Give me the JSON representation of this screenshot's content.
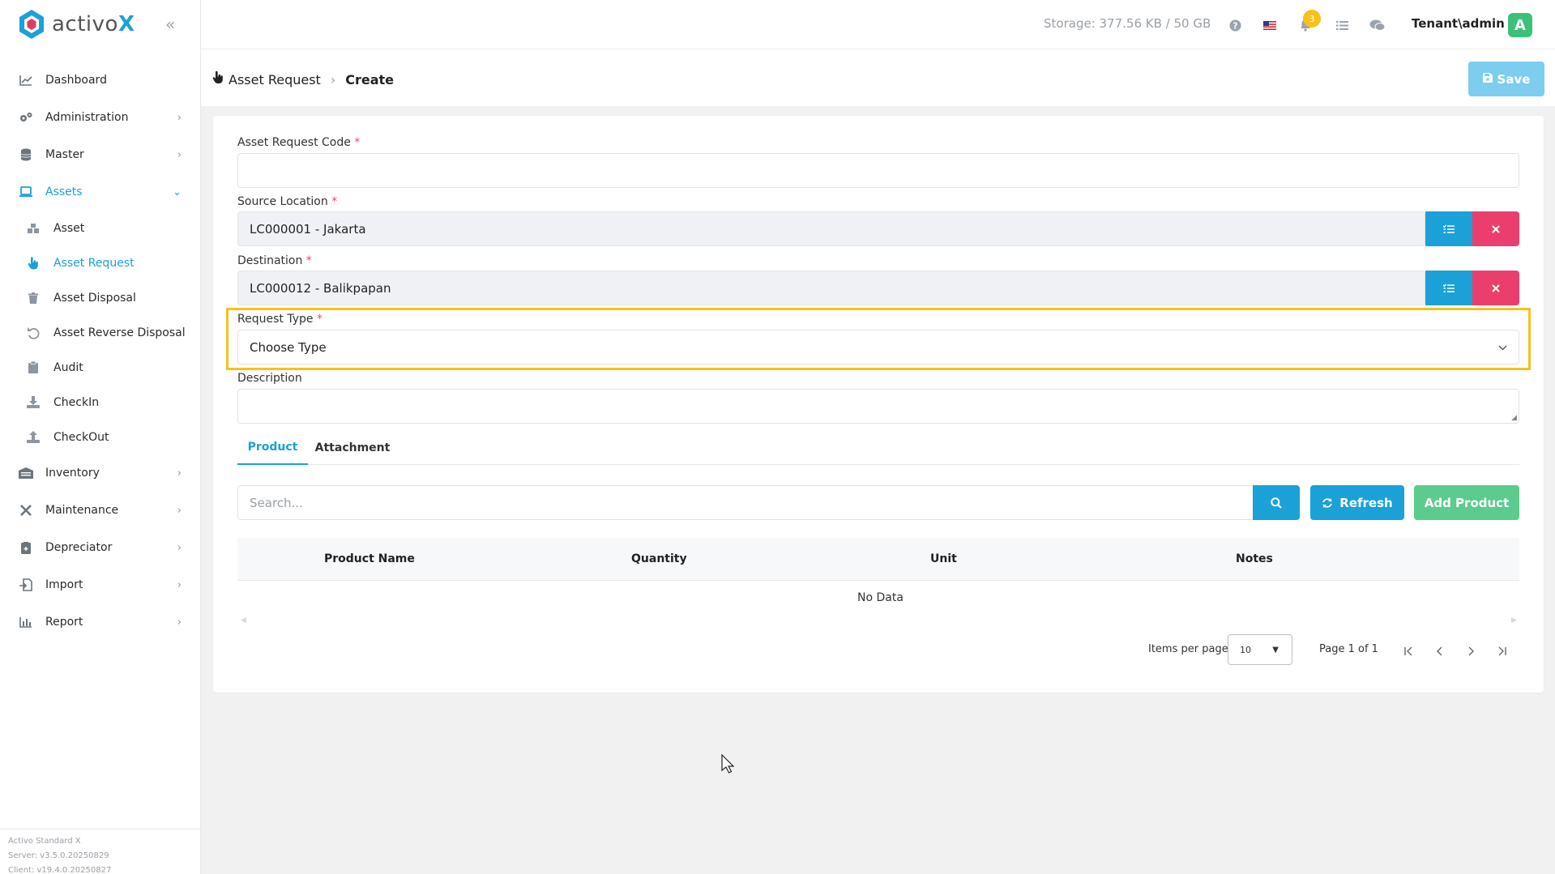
{
  "brand": {
    "name": "activo",
    "x": "X"
  },
  "sidebar": {
    "items": [
      {
        "label": "Dashboard",
        "icon": "chart-line-icon"
      },
      {
        "label": "Administration",
        "icon": "gears-icon"
      },
      {
        "label": "Master",
        "icon": "database-icon"
      },
      {
        "label": "Assets",
        "icon": "laptop-icon"
      },
      {
        "label": "Inventory",
        "icon": "warehouse-icon"
      },
      {
        "label": "Maintenance",
        "icon": "tools-icon"
      },
      {
        "label": "Depreciator",
        "icon": "calculator-icon"
      },
      {
        "label": "Import",
        "icon": "file-import-icon"
      },
      {
        "label": "Report",
        "icon": "bar-chart-icon"
      }
    ],
    "assets_sub": [
      {
        "label": "Asset",
        "icon": "boxes-icon"
      },
      {
        "label": "Asset Request",
        "icon": "hand-pointer-icon"
      },
      {
        "label": "Asset Disposal",
        "icon": "trash-icon"
      },
      {
        "label": "Asset Reverse Disposal",
        "icon": "undo-icon"
      },
      {
        "label": "Audit",
        "icon": "clipboard-icon"
      },
      {
        "label": "CheckIn",
        "icon": "download-icon"
      },
      {
        "label": "CheckOut",
        "icon": "upload-icon"
      }
    ],
    "footer": {
      "product": "Activo Standard X",
      "server": "Server: v3.5.0.20250829",
      "client": "Client: v19.4.0.20250827"
    }
  },
  "topbar": {
    "storage": "Storage: 377.56 KB / 50 GB",
    "notification_count": "3",
    "user": "Tenant\\admin",
    "avatar_letter": "A"
  },
  "breadcrumb": {
    "parent": "Asset Request",
    "current": "Create"
  },
  "save_label": "Save",
  "form": {
    "code_label": "Asset Request Code",
    "code_value": "",
    "source_label": "Source Location",
    "source_value": "LC000001 - Jakarta",
    "destination_label": "Destination",
    "destination_value": "LC000012 - Balikpapan",
    "request_type_label": "Request Type",
    "request_type_value": "Choose Type",
    "description_label": "Description",
    "required_mark": "*"
  },
  "tabs": [
    "Product",
    "Attachment"
  ],
  "product": {
    "search_placeholder": "Search...",
    "refresh_label": "Refresh",
    "add_label": "Add Product",
    "columns": [
      "Product Name",
      "Quantity",
      "Unit",
      "Notes"
    ],
    "empty": "No Data",
    "items_per_page_label": "Items per page",
    "items_per_page": "10",
    "page_info": "Page 1 of 1"
  },
  "colors": {
    "accent": "#1ba1d8",
    "danger": "#ea3f6d",
    "success": "#5bcc8d",
    "highlight": "#f4c21a"
  }
}
